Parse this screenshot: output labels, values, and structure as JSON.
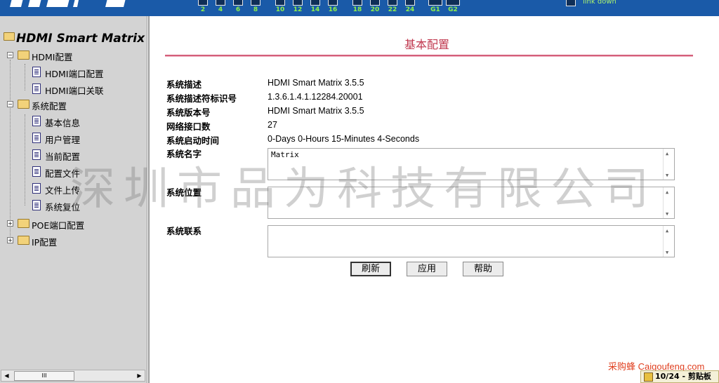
{
  "banner": {
    "ports": [
      "2",
      "4",
      "6",
      "8",
      "10",
      "12",
      "14",
      "16",
      "18",
      "20",
      "22",
      "24",
      "G1",
      "G2"
    ],
    "link_status": "link down",
    "accent_color": "#1a5aa8"
  },
  "sidebar": {
    "root_label": "HDMI Smart Matrix",
    "groups": [
      {
        "label": "HDMI配置",
        "expanded": true,
        "items": [
          "HDMI端口配置",
          "HDMI端口关联"
        ]
      },
      {
        "label": "系统配置",
        "expanded": true,
        "items": [
          "基本信息",
          "用户管理",
          "当前配置",
          "配置文件",
          "文件上传",
          "系统复位"
        ]
      },
      {
        "label": "POE端口配置",
        "expanded": false,
        "items": []
      },
      {
        "label": "IP配置",
        "expanded": false,
        "items": []
      }
    ],
    "scroll_thumb": "III"
  },
  "main": {
    "title": "基本配置",
    "fields": [
      {
        "label": "系统描述",
        "value": "HDMI Smart Matrix 3.5.5"
      },
      {
        "label": "系统描述符标识号",
        "value": "1.3.6.1.4.1.12284.20001"
      },
      {
        "label": "系统版本号",
        "value": "HDMI Smart Matrix 3.5.5"
      },
      {
        "label": "网络接口数",
        "value": "27"
      },
      {
        "label": "系统启动时间",
        "value": "0-Days 0-Hours 15-Minutes 4-Seconds"
      }
    ],
    "editable": [
      {
        "label": "系统名字",
        "value": "Matrix"
      },
      {
        "label": "系统位置",
        "value": ""
      },
      {
        "label": "系统联系",
        "value": ""
      }
    ],
    "buttons": {
      "refresh": "刷新",
      "apply": "应用",
      "help": "帮助"
    },
    "title_color": "#c0394f"
  },
  "watermark": "深圳市品为科技有限公司",
  "site_mark": "采购蜂 Caigoufeng.com",
  "clipboard": "10/24 - 剪贴板"
}
